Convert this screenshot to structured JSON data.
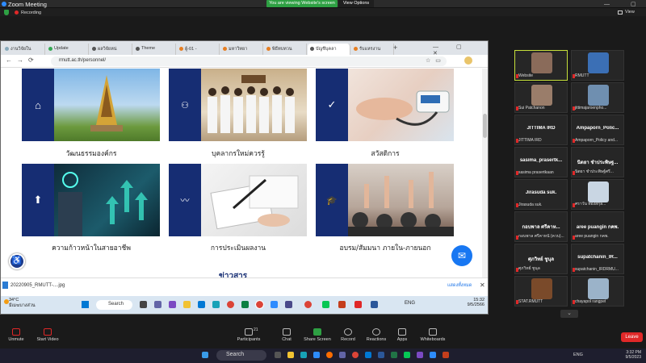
{
  "zoom": {
    "title": "Zoom Meeting",
    "share_banner": "You are viewing Website's screen",
    "view_options": "View Options",
    "recording": "Recording",
    "view": "View",
    "window_controls": "—  ▢  ✕"
  },
  "browser": {
    "tabs": [
      "งานวิจัยใน",
      "Update",
      "ผลวิจัยหน่",
      "Theme",
      "ผู้-01 -",
      "มหาวิทยา",
      "พิธีทบทวน",
      "บัญชีบุคลา",
      "รับแหรงาน"
    ],
    "url": "rmutt.ac.th/personnel/",
    "new_tab": "+",
    "window_controls": "— ▢ ✕"
  },
  "cards": [
    {
      "label": "วัฒนธรรมองค์กร",
      "icon": "home-icon",
      "glyph": "⌂"
    },
    {
      "label": "บุคลากรใหม่ควรรู้",
      "icon": "people-icon",
      "glyph": "👥"
    },
    {
      "label": "สวัสดิการ",
      "icon": "check-icon",
      "glyph": "✓"
    },
    {
      "label": "ความก้าวหน้าในสายอาชีพ",
      "icon": "arrow-up-icon",
      "glyph": "⬆"
    },
    {
      "label": "การประเมินผลงาน",
      "icon": "chart-line-icon",
      "glyph": "📈"
    },
    {
      "label": "อบรม/สัมมนา ภายใน-ภายนอก",
      "icon": "graduation-cap-icon",
      "glyph": "🎓"
    }
  ],
  "more_heading": "ข่าวสาร",
  "download": {
    "file": "20220905_RMUTT-....jpg",
    "show_all": "แสดงทั้งหมด",
    "close": "✕"
  },
  "win10": {
    "weather_temp": "34°C",
    "weather_desc": "มีเมฆบางส่วน",
    "search": "Search",
    "tray": "ENG",
    "time": "15:32",
    "date": "9/5/2566"
  },
  "participants": [
    {
      "name": "Website",
      "label": "",
      "active": true,
      "photo": true
    },
    {
      "name": "RMUTT",
      "label": "",
      "photo": true
    },
    {
      "name": "Sui Patchanon",
      "label": "",
      "photo": true
    },
    {
      "name": "jittimajaroenpho...",
      "label": "",
      "photo": true
    },
    {
      "name": "JITTIMA IRD",
      "label": "JITTIMA IRD"
    },
    {
      "name": "Ampaporn_Policy and...",
      "label": "Ampaporn_Polic..."
    },
    {
      "name": "sasima prasertkaan",
      "label": "sasima_prasertk..."
    },
    {
      "name": "นิตยา ชำประพิษฐ์ศรี...",
      "label": "นิตยา ชำประพิษฐ..."
    },
    {
      "name": "Jirasuda suk.",
      "label": "Jirasuda suk."
    },
    {
      "name": "ศราวัน ทองสกุล...",
      "label": "",
      "photo": true
    },
    {
      "name": "กอบพาล ศรีคาหนั (ควบ)...",
      "label": "กอบพาล ศรีคาห..."
    },
    {
      "name": "aree puangin กคพ.",
      "label": "aree puangin กคพ."
    },
    {
      "name": "ศุภวิทย์ ชูนุล",
      "label": "ศุภวิทย์ ชูนุล"
    },
    {
      "name": "supatchanin_IRDRMU...",
      "label": "supatchanin_IR..."
    },
    {
      "name": "STAT.RMUTT",
      "label": "",
      "photo": true
    },
    {
      "name": "chayapol rangpet",
      "label": "",
      "photo": true
    }
  ],
  "gallery_down": "⌄",
  "toolbar": {
    "unmute": "Unmute",
    "start_video": "Start Video",
    "participants": "Participants",
    "participants_count": "21",
    "chat": "Chat",
    "share_screen": "Share Screen",
    "record": "Record",
    "reactions": "Reactions",
    "apps": "Apps",
    "whiteboards": "Whiteboards",
    "leave": "Leave"
  },
  "win11": {
    "search": "Search",
    "tray": "ENG",
    "time": "3:32 PM",
    "date": "9/5/2023"
  },
  "colors": {
    "brand_navy": "#162d73",
    "zoom_green": "#2ea043",
    "leave_red": "#e02828"
  }
}
